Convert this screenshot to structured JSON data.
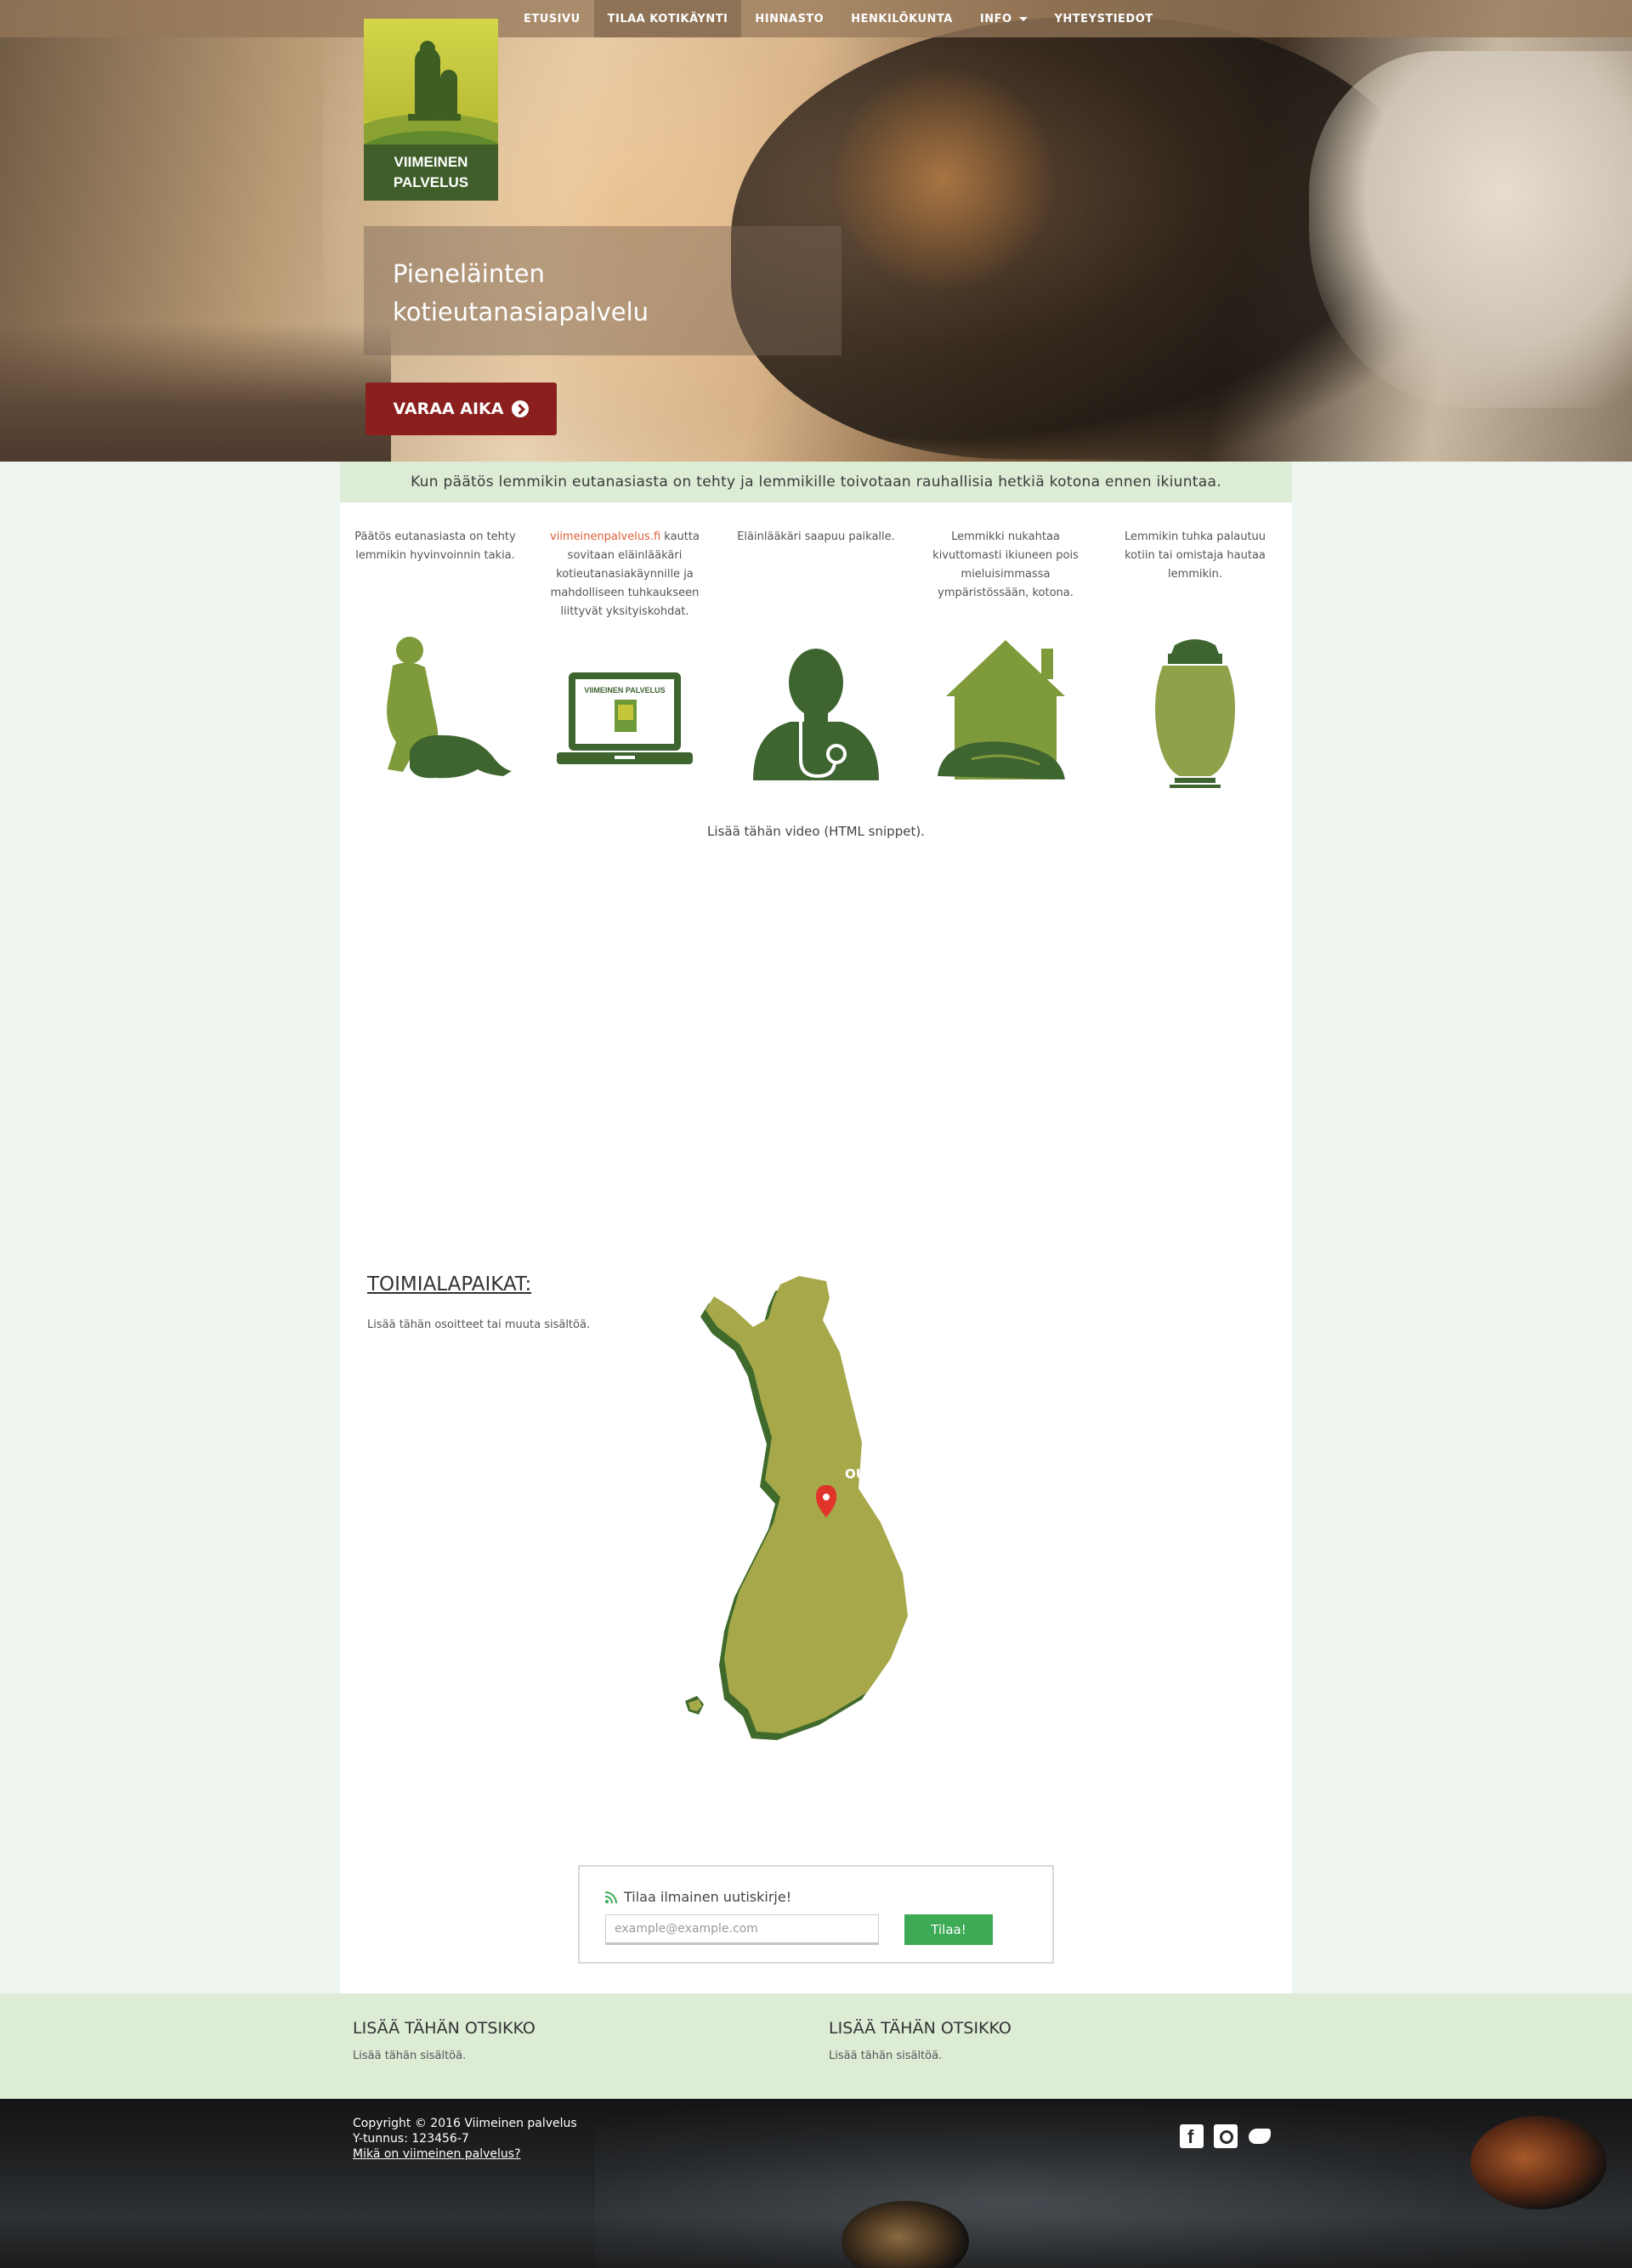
{
  "nav": {
    "items": [
      {
        "label": "ETUSIVU",
        "active": false
      },
      {
        "label": "TILAA KOTIKÄYNTI",
        "active": true
      },
      {
        "label": "HINNASTO",
        "active": false
      },
      {
        "label": "HENKILÖKUNTA",
        "active": false
      },
      {
        "label": "INFO",
        "active": false,
        "dropdown": true
      },
      {
        "label": "YHTEYSTIEDOT",
        "active": false
      }
    ]
  },
  "logo": {
    "line1": "VIIMEINEN",
    "line2": "PALVELUS"
  },
  "hero": {
    "tagline_line1": "Pieneläinten",
    "tagline_line2": "kotieutanasiapalvelu",
    "cta_label": "VARAA AIKA"
  },
  "intro": "Kun päätös lemmikin eutanasiasta on tehty ja lemmikille toivotaan rauhallisia hetkiä kotona ennen ikiuntaa.",
  "steps": [
    {
      "text": "Päätös eutanasiasta on tehty lemmikin hyvinvoinnin takia.",
      "icon": "person-with-dog-icon"
    },
    {
      "link": "viimeinenpalvelus.fi",
      "text": " kautta sovitaan eläinlääkäri kotieutanasiakäynnille ja mahdolliseen tuhkaukseen liittyvät yksityiskohdat.",
      "icon": "laptop-icon",
      "laptop_brand": "VIIMEINEN PALVELUS"
    },
    {
      "text": "Eläinlääkäri saapuu paikalle.",
      "icon": "veterinarian-icon"
    },
    {
      "text": "Lemmikki nukahtaa kivuttomasti ikiuneen pois mieluisimmassa ympäristössään, kotona.",
      "icon": "house-with-sleeping-dog-icon"
    },
    {
      "text": "Lemmikin tuhka palautuu kotiin tai omistaja hautaa lemmikin.",
      "icon": "urn-icon"
    }
  ],
  "video_note": "Lisää tähän video (HTML snippet).",
  "locations": {
    "title": "TOIMIALAPAIKAT:",
    "text": "Lisää tähän osoitteet tai muuta sisältöä.",
    "map_label": "OULU"
  },
  "newsletter": {
    "heading": "Tilaa ilmainen uutiskirje!",
    "placeholder": "example@example.com",
    "button": "Tilaa!"
  },
  "footer_columns": [
    {
      "title": "LISÄÄ TÄHÄN OTSIKKO",
      "text": "Lisää tähän sisältöä."
    },
    {
      "title": "LISÄÄ TÄHÄN OTSIKKO",
      "text": "Lisää tähän sisältöä."
    }
  ],
  "footer": {
    "copyright": "Copyright © 2016 Viimeinen palvelus",
    "business_id": "Y-tunnus: 123456-7",
    "about_link": "Mikä on viimeinen palvelus?",
    "social": [
      "facebook-icon",
      "instagram-icon",
      "twitter-icon"
    ]
  },
  "colors": {
    "nav_bg": "#96785a",
    "cta": "#8a1f1d",
    "intro_bar": "#dcecd5",
    "icon_green_dark": "#3e6430",
    "icon_green_light": "#7f9a3a",
    "map_fill": "#a7a84a",
    "map_edge": "#3f6a2c",
    "pin": "#e0342a",
    "button_green": "#3daa56",
    "link_orange": "#e0603a"
  }
}
